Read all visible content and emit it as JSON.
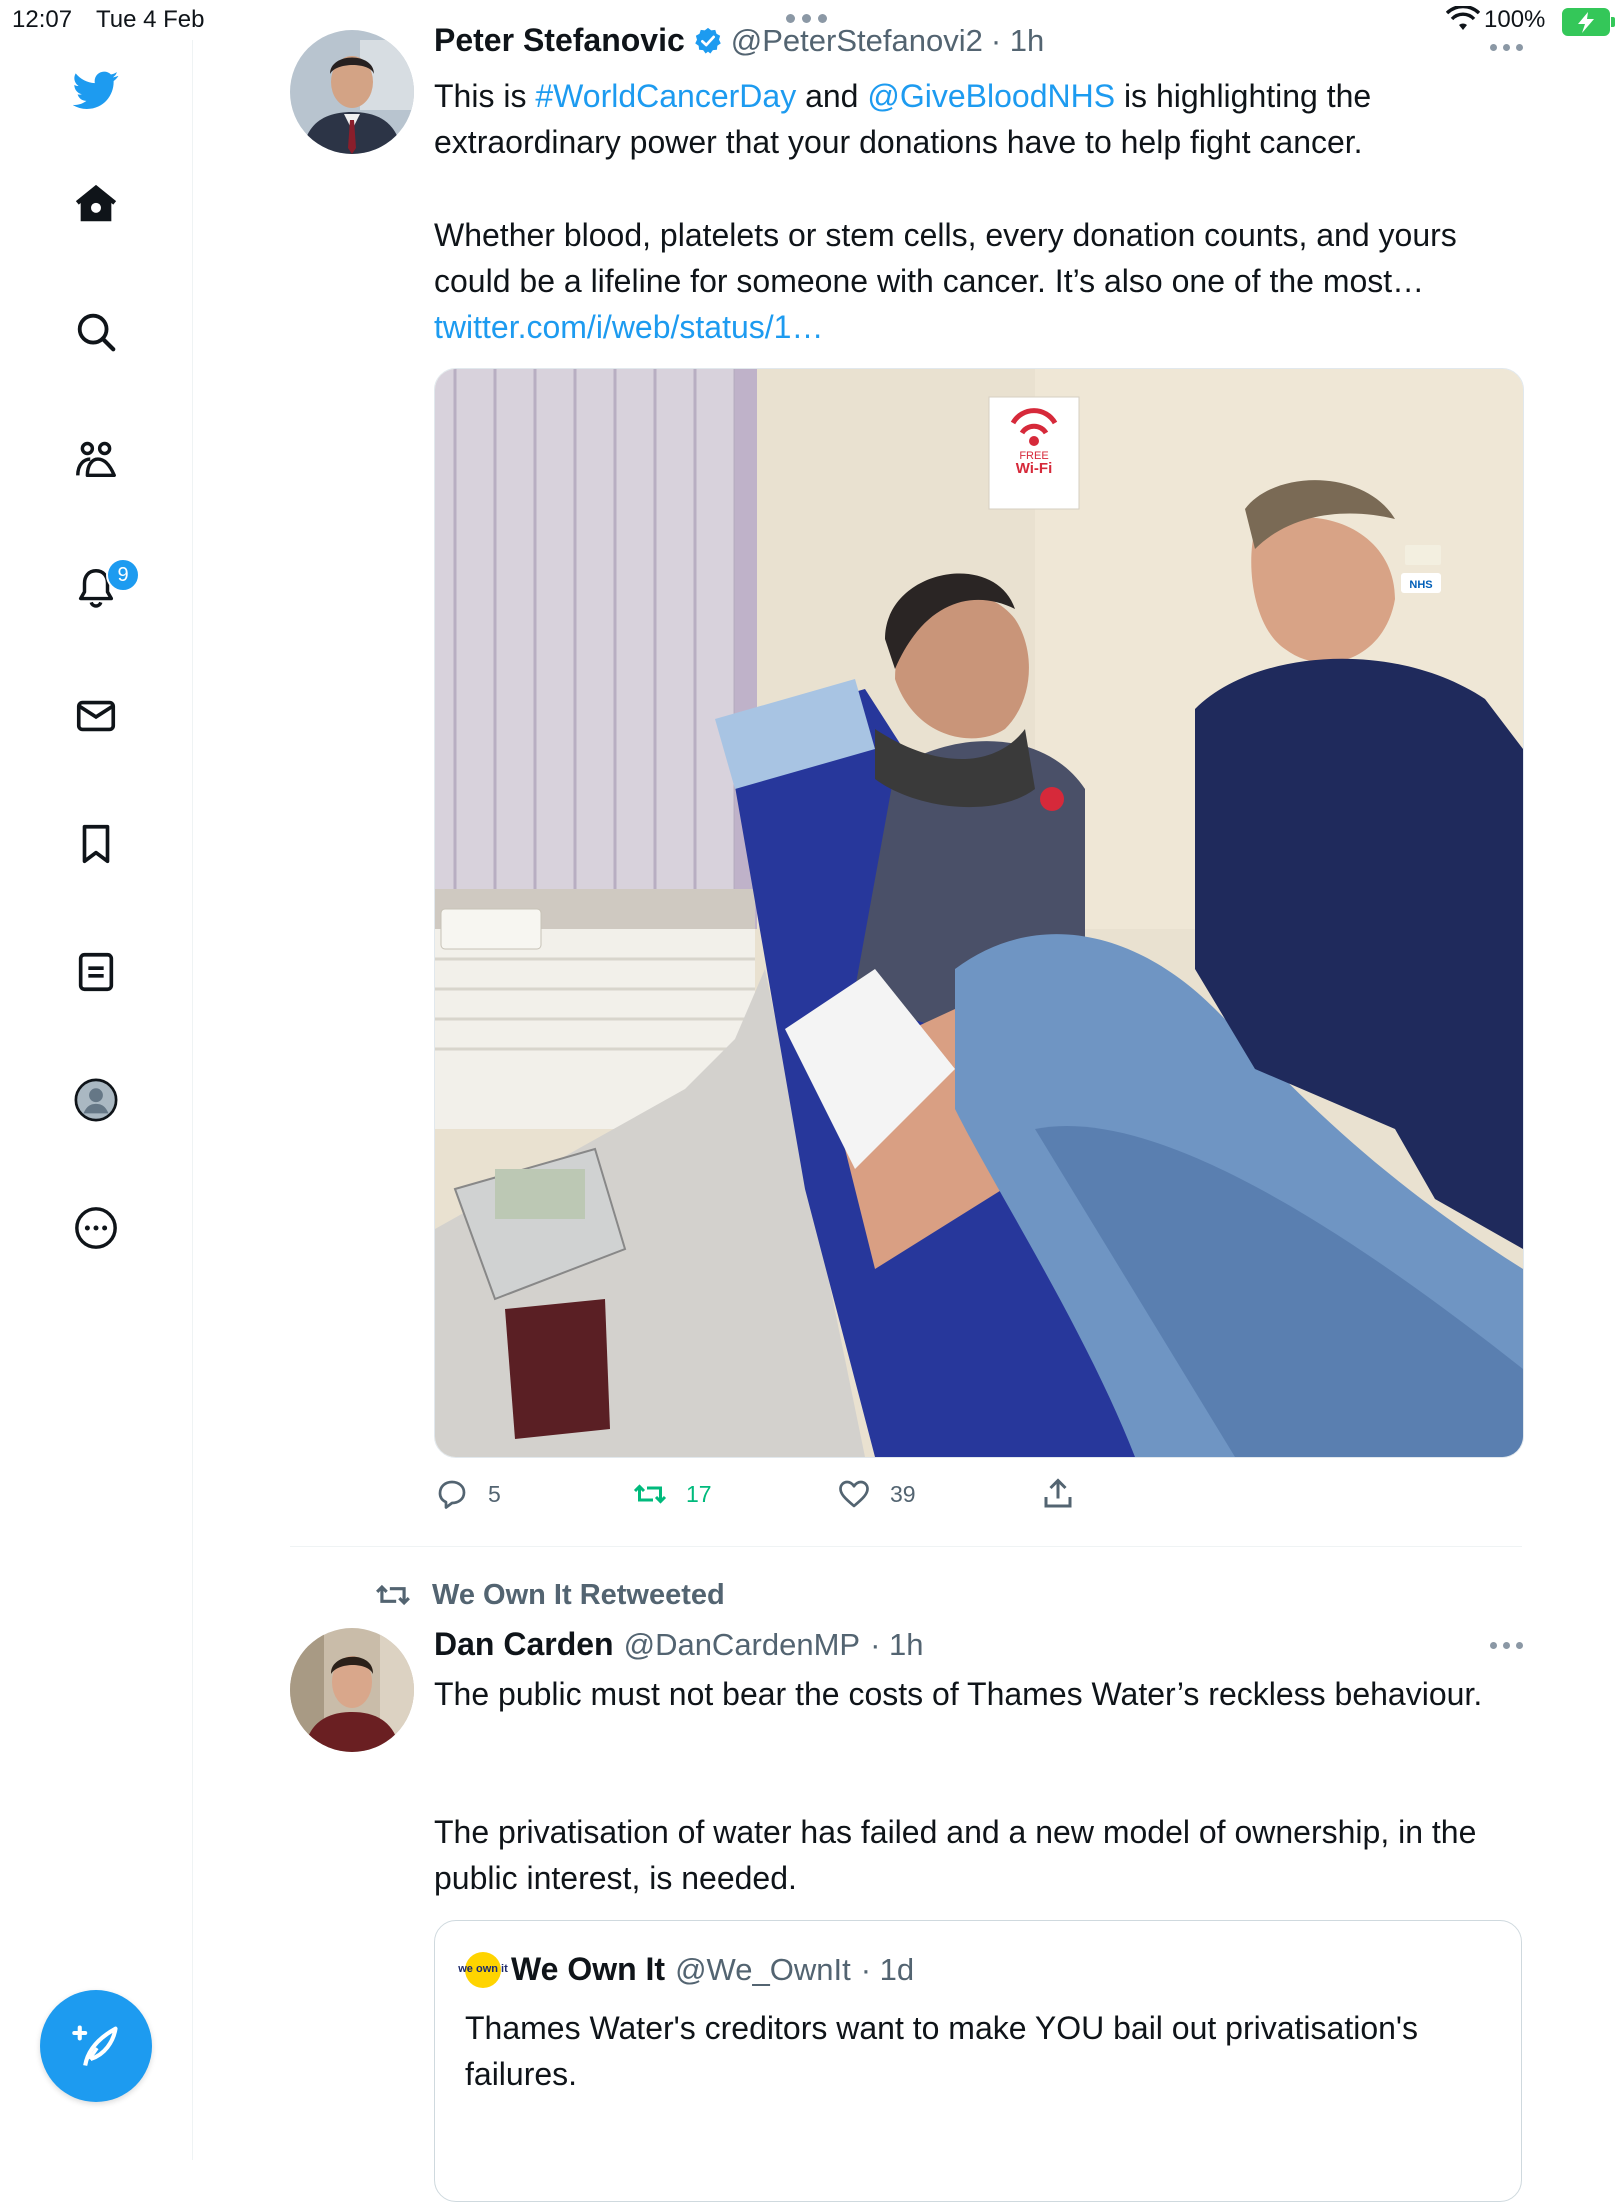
{
  "status_bar": {
    "time": "12:07",
    "date": "Tue 4 Feb",
    "battery": "100%",
    "icons": [
      "wifi-icon",
      "battery-charging-icon",
      "multitask-dots-icon"
    ]
  },
  "sidebar": {
    "items": [
      {
        "name": "twitter-logo-icon"
      },
      {
        "name": "home-icon"
      },
      {
        "name": "search-icon"
      },
      {
        "name": "communities-icon"
      },
      {
        "name": "notifications-icon",
        "badge": "9"
      },
      {
        "name": "messages-icon"
      },
      {
        "name": "bookmarks-icon"
      },
      {
        "name": "lists-icon"
      },
      {
        "name": "profile-icon"
      },
      {
        "name": "more-icon"
      }
    ],
    "compose_icon": "compose-tweet-icon"
  },
  "colors": {
    "accent": "#1d9bf0",
    "retweet_green": "#00ba7c",
    "secondary_text": "#536471"
  },
  "tweet1": {
    "name": "Peter Stefanovic",
    "verified": true,
    "handle": "@PeterStefanovi2",
    "time": "· 1h",
    "text_a": "This is ",
    "hashtag": "#WorldCancerDay",
    "text_b": " and ",
    "mention": "@GiveBloodNHS",
    "text_c": " is highlighting the extraordinary power that your donations have to help fight cancer.",
    "paragraph2": "Whether blood, platelets or stem cells, every donation counts, and yours could be a lifeline for someone with cancer. It’s also one of the most… ",
    "link": "twitter.com/i/web/status/1…",
    "image": {
      "sign_free": "FREE",
      "sign_wifi": "Wi-Fi",
      "badge_nhs": "NHS"
    },
    "replies": "5",
    "retweets": "17",
    "likes": "39"
  },
  "tweet2": {
    "retweeted_by": "We Own It Retweeted",
    "name": "Dan Carden",
    "handle": "@DanCardenMP",
    "time": "· 1h",
    "paragraph1": "The public must not bear the costs of Thames Water’s reckless behaviour.",
    "paragraph2": "The privatisation of water has failed and a new model of ownership, in the public interest, is needed.",
    "quote": {
      "logo_text": "we own it",
      "name": "We Own It",
      "handle": "@We_OwnIt",
      "time": "· 1d",
      "text": "Thames Water's creditors want to make YOU bail out privatisation's failures."
    }
  }
}
